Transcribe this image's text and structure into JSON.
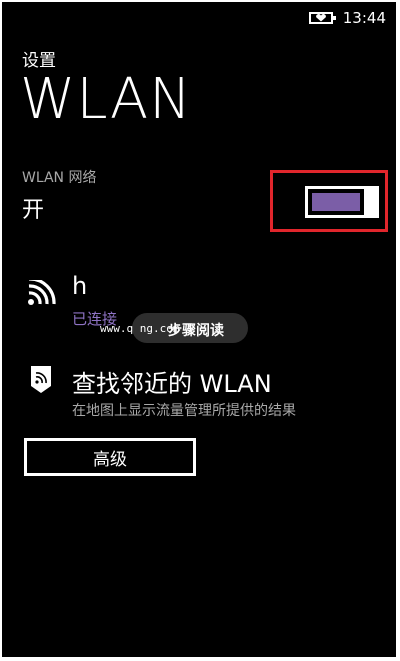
{
  "status_bar": {
    "time": "13:44",
    "battery_icon": "battery-charging-icon"
  },
  "header": {
    "section": "设置",
    "title": "WLAN"
  },
  "wlan_toggle": {
    "label": "WLAN 网络",
    "state_text": "开",
    "is_on": true,
    "accent_color": "#7b5ea7",
    "highlight_color": "#e1262c"
  },
  "connected_network": {
    "icon": "wifi-signal-icon",
    "name": "h",
    "status": "已连接",
    "status_color": "#8e73c4"
  },
  "watermark": {
    "url": "www.q                ng.com",
    "text": "步骤阅读"
  },
  "find_nearby": {
    "icon": "map-tag-wifi-icon",
    "title": "查找邻近的 WLAN",
    "subtitle": "在地图上显示流量管理所提供的结果"
  },
  "advanced": {
    "label": "高级"
  }
}
